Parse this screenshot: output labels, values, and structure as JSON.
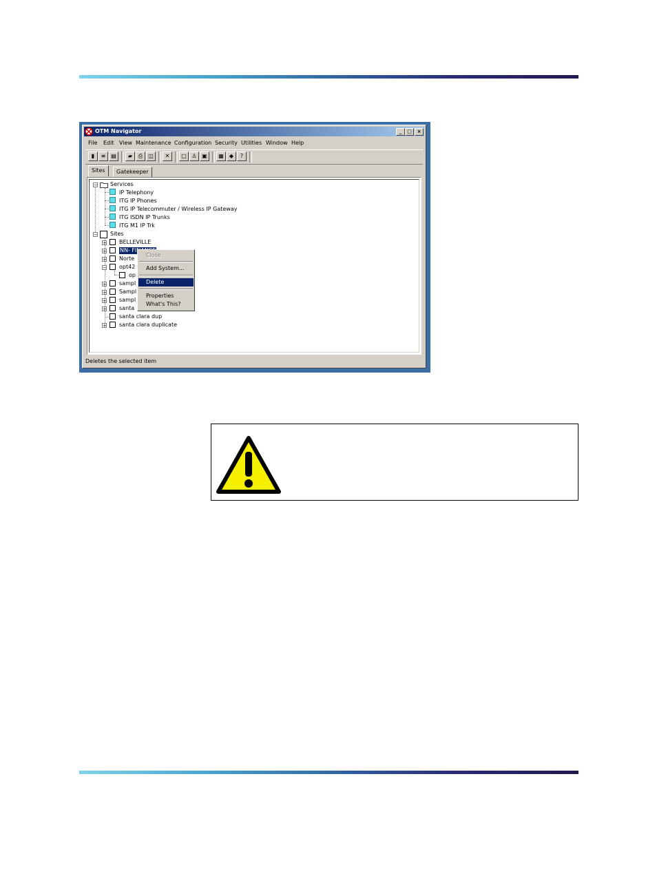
{
  "window": {
    "title": "OTM Navigator",
    "caption_buttons": [
      "_",
      "□",
      "×"
    ]
  },
  "menu": [
    "File",
    "Edit",
    "View",
    "Maintenance",
    "Configuration",
    "Security",
    "Utilities",
    "Window",
    "Help"
  ],
  "tabs": {
    "sites": "Sites",
    "gatekeeper": "Gatekeeper Zones"
  },
  "tree": {
    "services": "Services",
    "service_items": [
      "IP Telephony",
      "ITG IP Phones",
      "ITG IP Telecommuter / Wireless IP Gateway",
      "ITG ISDN IP Trunks",
      "ITG M1 IP Trk"
    ],
    "sites": "Sites",
    "site_items": [
      "BELLEVILLE",
      "NN- FINANCE",
      "Norte",
      "opt42",
      "op",
      "sampl",
      "Sampl",
      "sampl",
      "santa",
      "santa clara dup",
      "santa clara duplicate"
    ]
  },
  "context_menu": {
    "close": "Close",
    "add_system": "Add System...",
    "delete": "Delete",
    "properties": "Properties",
    "whats_this": "What's This?"
  },
  "status": "Deletes the selected item",
  "colors": {
    "rule_start": "#7fd3ea",
    "rule_end": "#1f1a4e",
    "selection": "#0a246a",
    "warning_yellow": "#f5f000"
  }
}
